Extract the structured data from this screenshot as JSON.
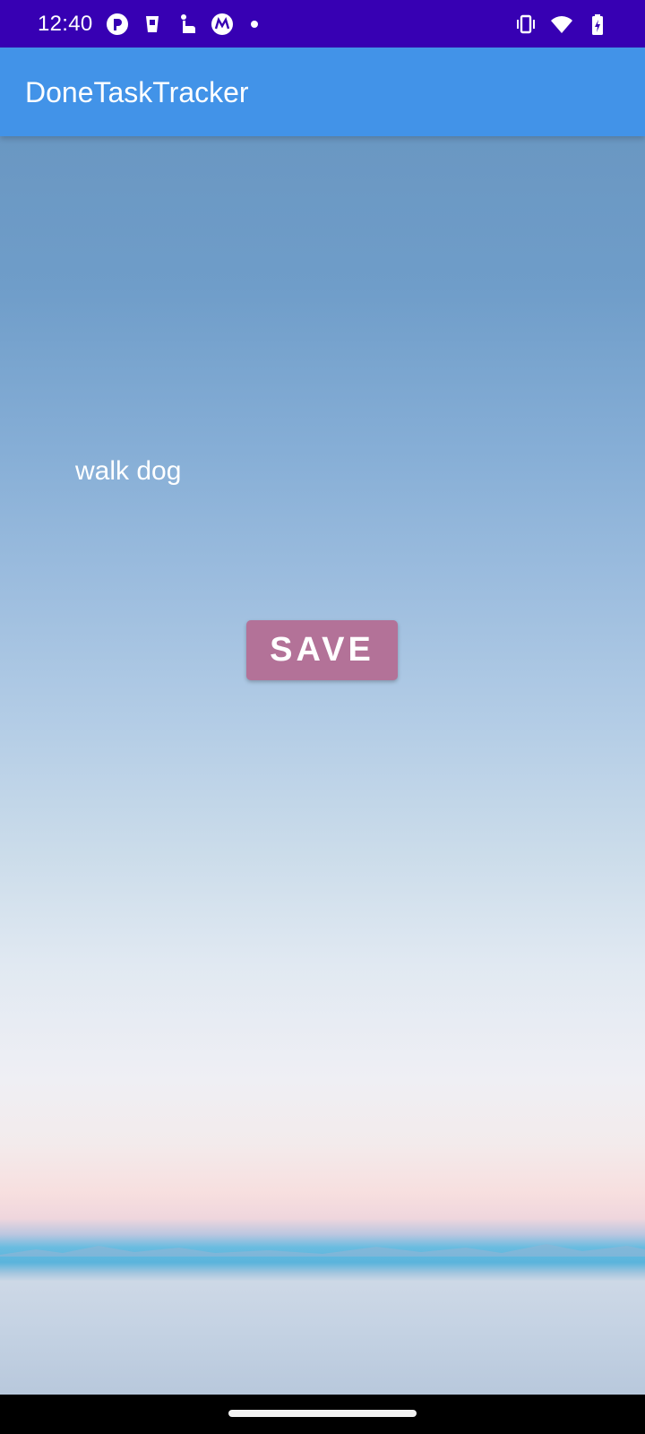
{
  "status_bar": {
    "time": "12:40",
    "left_icons": [
      "notification-p-icon",
      "cup-icon",
      "touch-gesture-icon",
      "motorola-icon",
      "more-dot-icon"
    ],
    "right_icons": [
      "vibrate-icon",
      "wifi-icon",
      "battery-charging-icon"
    ],
    "background": "#3700b3"
  },
  "app_bar": {
    "title": "DoneTaskTracker",
    "background": "#4293e8"
  },
  "main": {
    "task_value": "walk dog",
    "save_label": "SAVE",
    "save_color": "#b37298"
  }
}
